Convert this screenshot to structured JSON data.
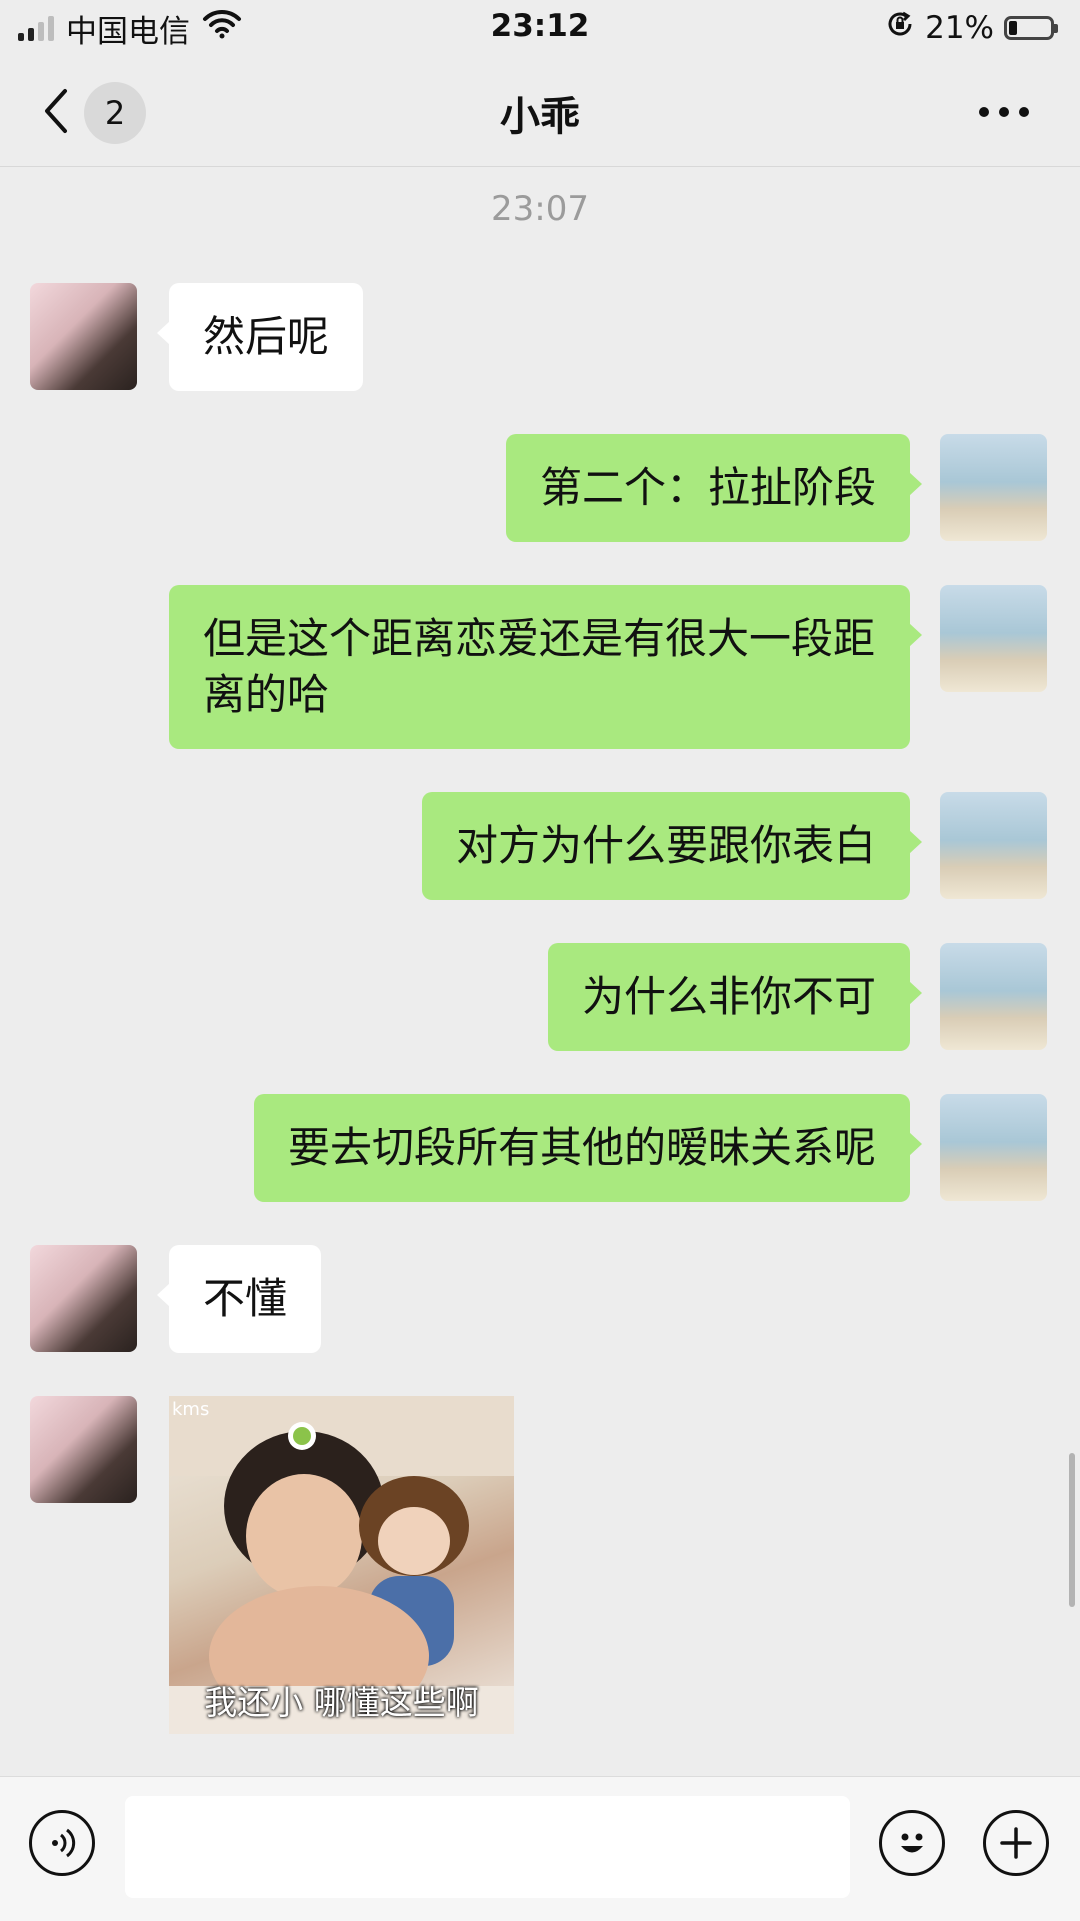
{
  "status_bar": {
    "carrier": "中国电信",
    "time": "23:12",
    "battery_percent": "21%",
    "battery_level": 0.21,
    "signal_icon": "cellular-signal-icon",
    "wifi_icon": "wifi-icon",
    "rotation_lock_icon": "rotation-lock-icon"
  },
  "nav": {
    "title": "小乖",
    "unread_count": "2",
    "back_icon": "chevron-left-icon",
    "more_icon": "more-dots-icon"
  },
  "chat": {
    "timestamp": "23:07",
    "messages": [
      {
        "from": "other",
        "text": "然后呢"
      },
      {
        "from": "me",
        "text": "第二个：拉扯阶段"
      },
      {
        "from": "me",
        "text": "但是这个距离恋爱还是有很大一段距离的哈"
      },
      {
        "from": "me",
        "text": "对方为什么要跟你表白"
      },
      {
        "from": "me",
        "text": "为什么非你不可"
      },
      {
        "from": "me",
        "text": "要去切段所有其他的暧昧关系呢"
      },
      {
        "from": "other",
        "text": "不懂"
      },
      {
        "from": "other",
        "type": "sticker",
        "tag": "kms",
        "caption": "我还小  哪懂这些啊"
      }
    ]
  },
  "input_bar": {
    "text_value": "",
    "voice_icon": "voice-icon",
    "emoji_icon": "emoji-icon",
    "plus_icon": "plus-icon"
  },
  "colors": {
    "background": "#ededed",
    "my_bubble": "#a9e97f",
    "other_bubble": "#ffffff"
  }
}
